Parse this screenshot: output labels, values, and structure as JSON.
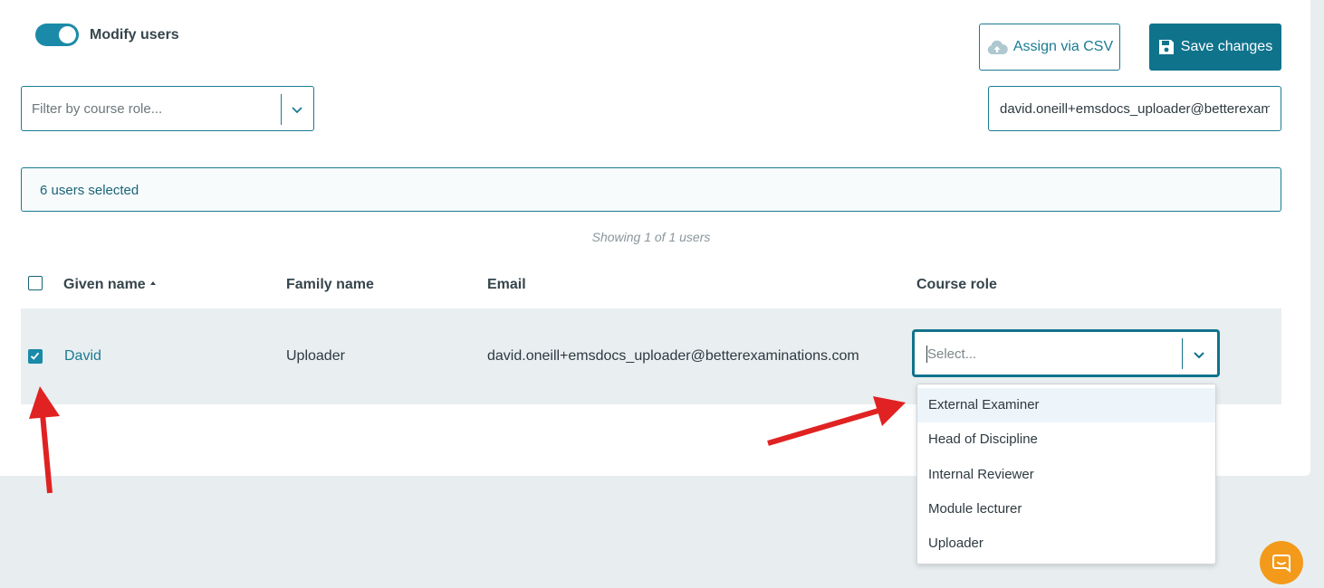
{
  "toggle": {
    "label": "Modify users",
    "on": true
  },
  "actions": {
    "assign_csv_label": "Assign via CSV",
    "save_label": "Save changes"
  },
  "filter": {
    "placeholder": "Filter by course role..."
  },
  "search": {
    "value": "david.oneill+emsdocs_uploader@betterexaminations.com"
  },
  "selection": {
    "text": "6 users selected"
  },
  "showing": {
    "text": "Showing 1 of 1 users"
  },
  "table": {
    "headers": {
      "given_name": "Given name",
      "family_name": "Family name",
      "email": "Email",
      "course_role": "Course role"
    },
    "rows": [
      {
        "given_name": "David",
        "family_name": "Uploader",
        "email": "david.oneill+emsdocs_uploader@betterexaminations.com",
        "role_placeholder": "Select...",
        "checked": true
      }
    ]
  },
  "role_dropdown": {
    "options": [
      "External Examiner",
      "Head of Discipline",
      "Internal Reviewer",
      "Module lecturer",
      "Uploader"
    ],
    "highlighted_index": 0
  },
  "colors": {
    "accent": "#10738c",
    "annotation_arrow": "#e02222",
    "chat_button": "#f39a1b"
  },
  "icons": {
    "upload": "cloud-upload-icon",
    "save": "floppy-disk-icon",
    "chevron": "chevron-down-icon",
    "chat": "chat-bubble-icon",
    "check": "checkmark-icon"
  }
}
